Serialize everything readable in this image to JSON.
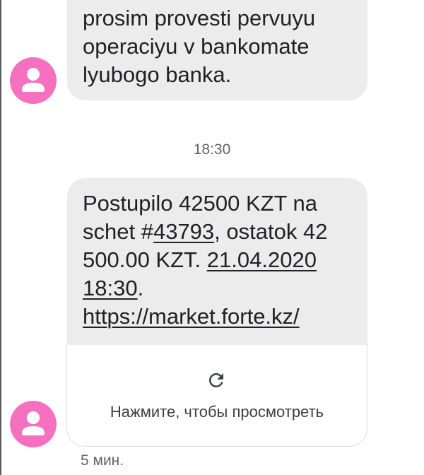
{
  "messages": [
    {
      "lines": [
        "prosim provesti pervuyu",
        "operaciyu v bankomate",
        "lyubogo banka."
      ]
    }
  ],
  "separator_time": "18:30",
  "sms": {
    "line1": "Postupilo 42500 KZT na",
    "line2_prefix": "schet #",
    "account": "43793",
    "line2_suffix": ", ostatok 42",
    "line3_prefix": "500.00 KZT. ",
    "date": "21.04.2020",
    "time": "18:30",
    "line4_suffix": ".",
    "link": "https://market.forte.kz/"
  },
  "link_preview": {
    "icon": "refresh-icon",
    "label": "Нажмите, чтобы просмотреть"
  },
  "message_age": "5 мин.",
  "colors": {
    "avatar": "#f571bf",
    "bubble": "#ececec",
    "text": "#202124"
  }
}
